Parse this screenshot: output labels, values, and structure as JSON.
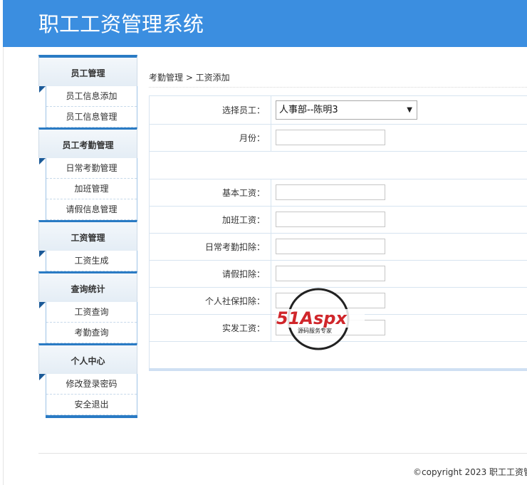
{
  "header": {
    "title": "职工工资管理系统"
  },
  "sidebar": {
    "groups": [
      {
        "title": "员工管理",
        "items": [
          "员工信息添加",
          "员工信息管理"
        ]
      },
      {
        "title": "员工考勤管理",
        "items": [
          "日常考勤管理",
          "加班管理",
          "请假信息管理"
        ]
      },
      {
        "title": "工资管理",
        "items": [
          "工资生成"
        ]
      },
      {
        "title": "查询统计",
        "items": [
          "工资查询",
          "考勤查询"
        ]
      },
      {
        "title": "个人中心",
        "items": [
          "修改登录密码",
          "安全退出"
        ]
      }
    ]
  },
  "breadcrumb": {
    "text": "考勤管理 > 工资添加"
  },
  "form": {
    "employee_label": "选择员工：",
    "employee_value": "人事部--陈明3",
    "month_label": "月份：",
    "base_label": "基本工资：",
    "overtime_label": "加班工资：",
    "attendance_label": "日常考勤扣除：",
    "leave_label": "请假扣除：",
    "social_label": "个人社保扣除：",
    "actual_label": "实发工资："
  },
  "watermark": {
    "brand": "51Aspx",
    "tagline": "源码服务专家"
  },
  "footer": {
    "copyright": "©copyright 2023 职工工资管"
  }
}
